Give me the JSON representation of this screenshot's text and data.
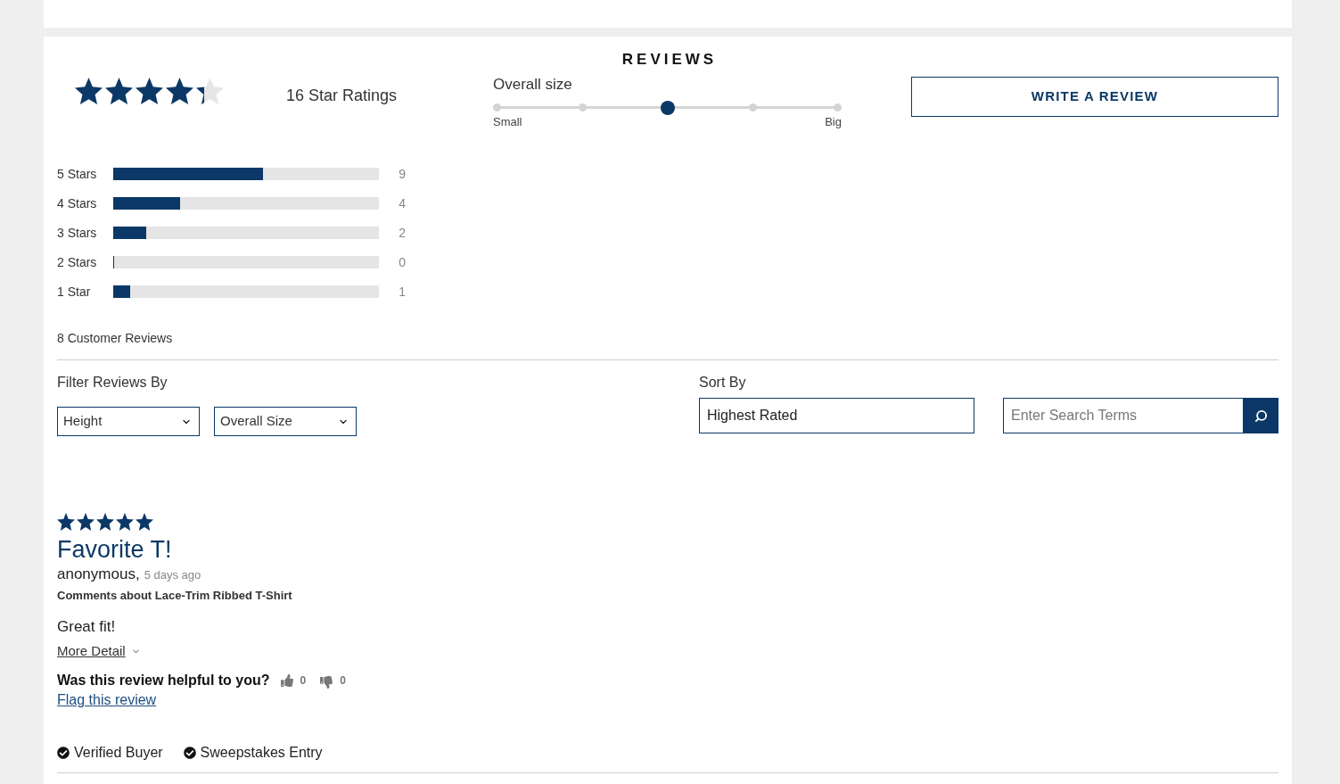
{
  "reviews_section": {
    "heading": "REVIEWS",
    "summary": {
      "stars": 4.3,
      "ratings_count": "16 Star Ratings"
    },
    "overall_size": {
      "label": "Overall size",
      "level": 0.5,
      "min_label": "Small",
      "max_label": "Big"
    },
    "write_review_button": "WRITE A REVIEW",
    "histogram": [
      {
        "label": "5 Stars",
        "level": 0.5625,
        "count": "9"
      },
      {
        "label": "4 Stars",
        "level": 0.25,
        "count": "4"
      },
      {
        "label": "3 Stars",
        "level": 0.125,
        "count": "2"
      },
      {
        "label": "2 Stars",
        "level": 0,
        "count": "0"
      },
      {
        "label": "1 Star",
        "level": 0.0625,
        "count": "1"
      }
    ],
    "customer_reviews_count": "8 Customer Reviews",
    "filter": {
      "label": "Filter Reviews By",
      "dropdowns": [
        {
          "value": "Height"
        },
        {
          "value": "Overall Size"
        }
      ]
    },
    "sort": {
      "label": "Sort By",
      "value": "Highest Rated"
    },
    "search": {
      "placeholder": "Enter Search Terms"
    },
    "reviews": [
      {
        "stars": 5,
        "title": "Favorite T!",
        "author": "anonymous,",
        "date": "5 days ago",
        "product_line": "Comments about Lace-Trim Ribbed T-Shirt",
        "body": "Great fit!",
        "more_detail": "More Detail",
        "helpful_question": "Was this review helpful to you?",
        "helpful_yes": "0",
        "helpful_no": "0",
        "flag_link": "Flag this review",
        "badges": [
          "Verified Buyer",
          "Sweepstakes Entry"
        ]
      }
    ]
  }
}
